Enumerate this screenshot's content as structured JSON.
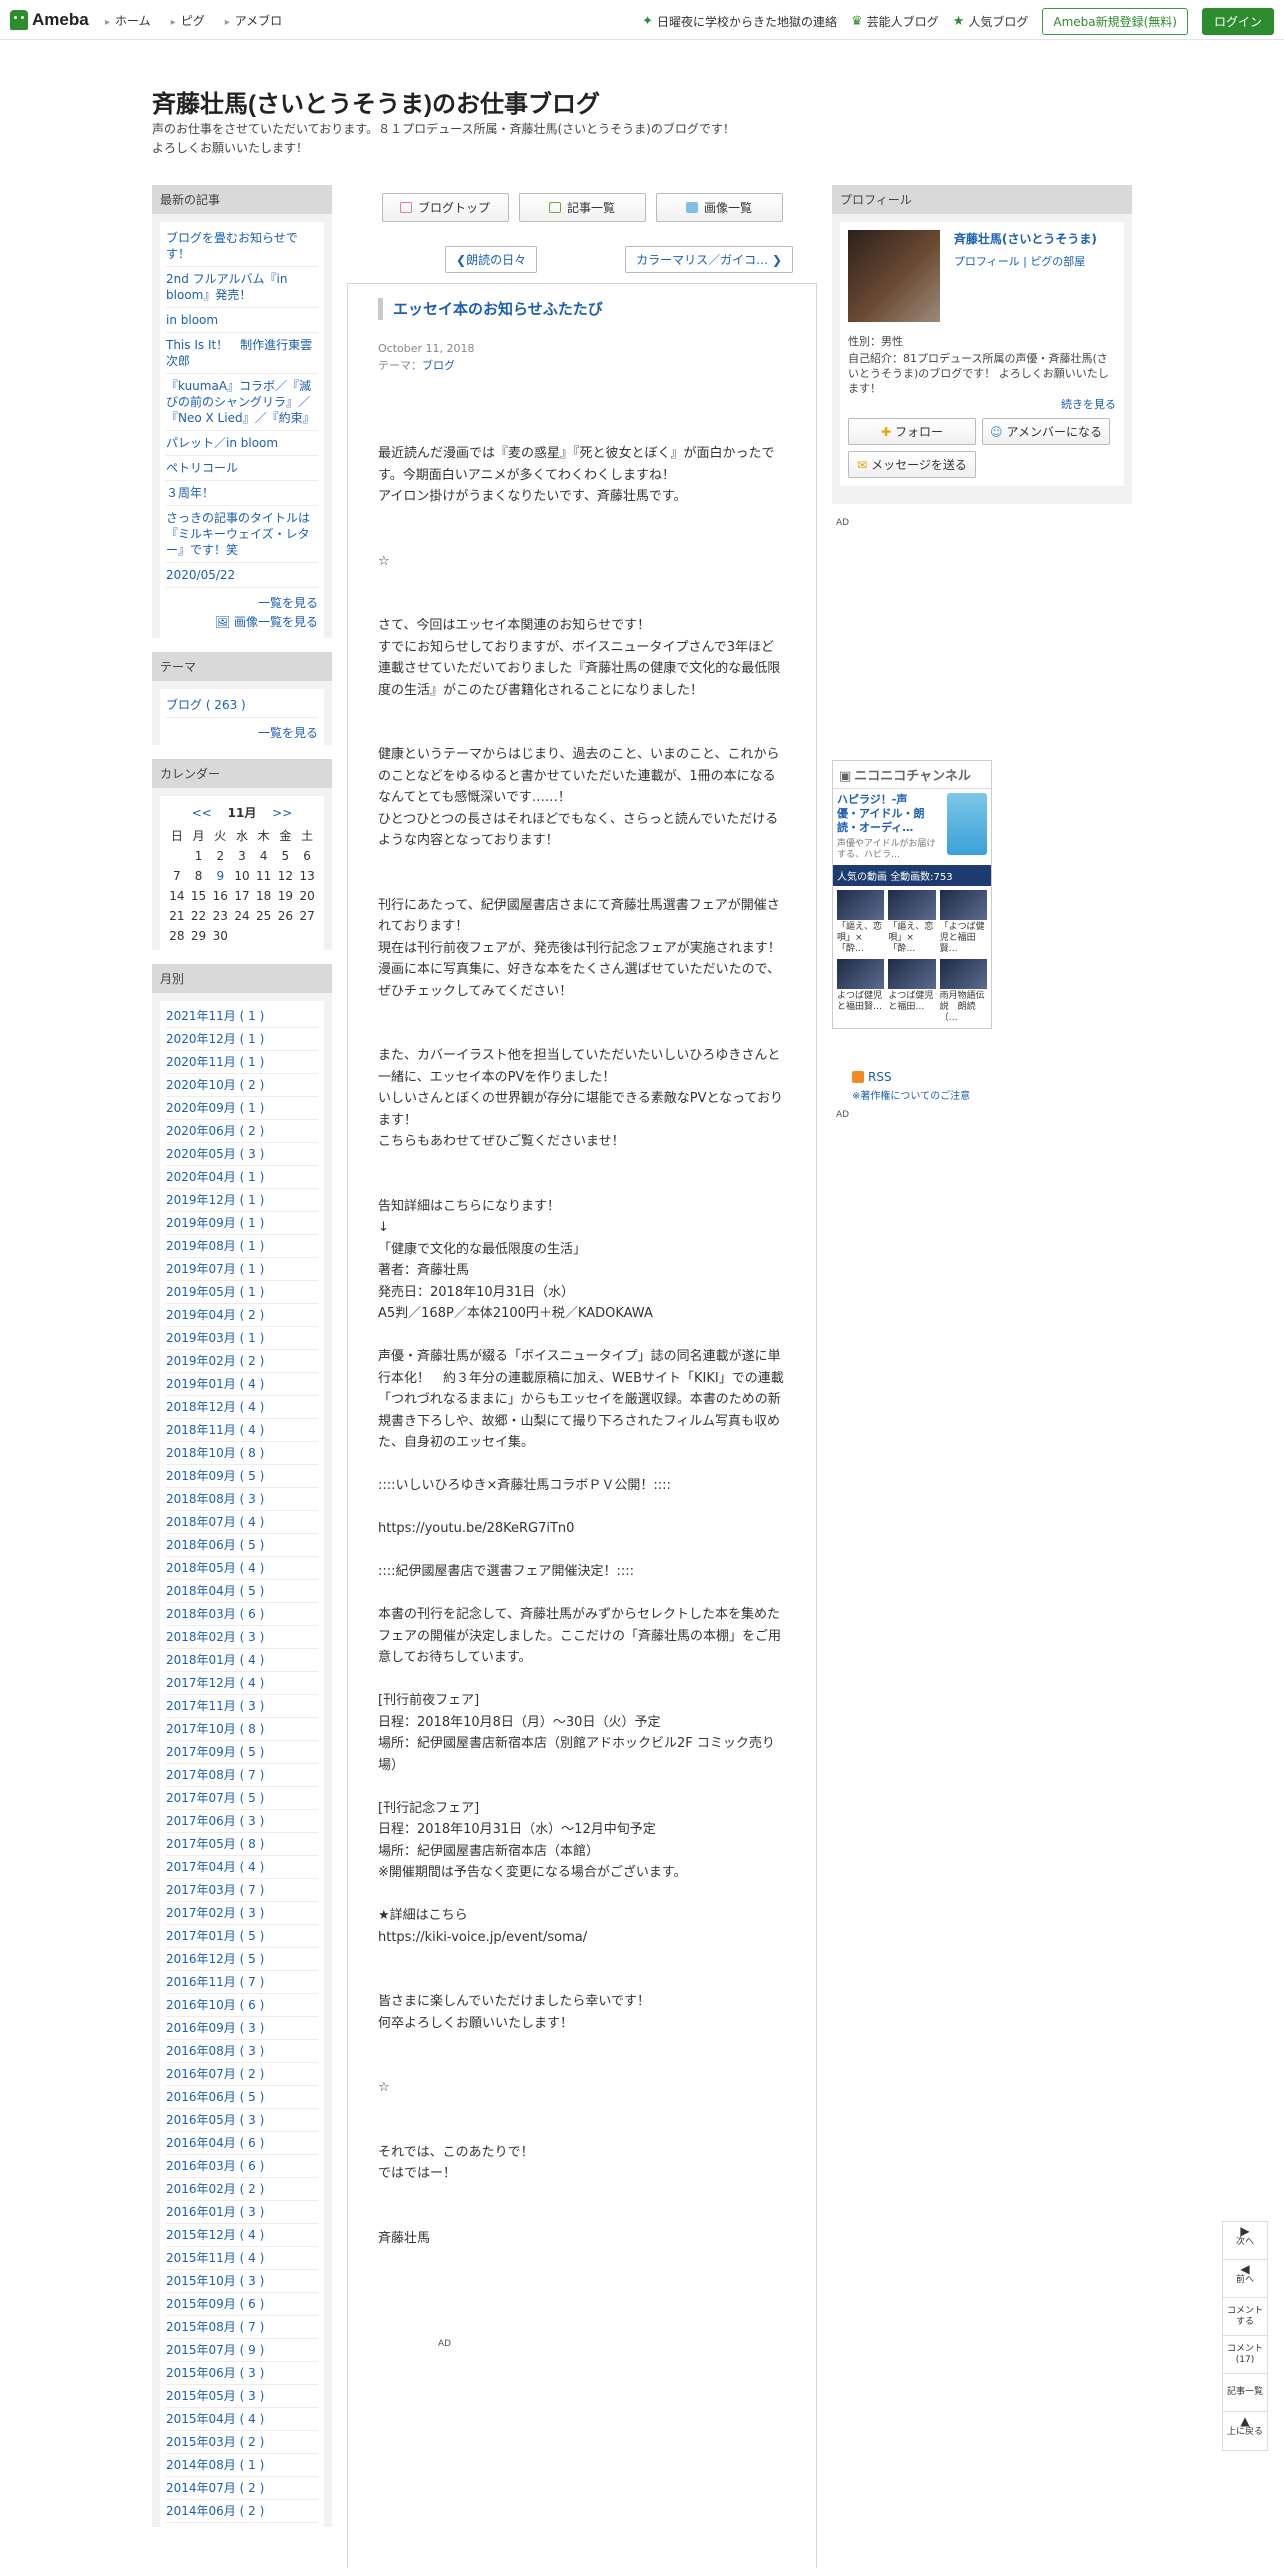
{
  "header": {
    "logo_text": "Ameba",
    "nav": [
      "ホーム",
      "ピグ",
      "アメブロ"
    ],
    "news_link": "日曜夜に学校からきた地獄の連絡",
    "celeb_link": "芸能人ブログ",
    "popular_link": "人気ブログ",
    "register_label": "Ameba新規登録(無料)",
    "login_label": "ログイン"
  },
  "blog": {
    "title": "斉藤壮馬(さいとうそうま)のお仕事ブログ",
    "desc_line1": "声のお仕事をさせていただいております。８１プロデュース所属・斉藤壮馬(さいとうそうま)のブログです！",
    "desc_line2": "よろしくお願いいたします！"
  },
  "left": {
    "recent_title": "最新の記事",
    "recent": [
      "ブログを畳むお知らせです！",
      "2nd フルアルバム『in bloom』発売！",
      "in bloom",
      "This Is It！　制作進行東雲次郎",
      "『kuumaA』コラボ／『滅びの前のシャングリラ』／『Neo X Lied』／『約束』",
      "パレット／in bloom",
      "ペトリコール",
      "３周年！",
      "さっきの記事のタイトルは『ミルキーウェイズ・レター』です！笑",
      "2020/05/22"
    ],
    "list_more": "一覧を見る",
    "image_more": "画像一覧を見る",
    "theme_title": "テーマ",
    "theme_item": "ブログ ( 263 )",
    "theme_more": "一覧を見る",
    "calendar_title": "カレンダー",
    "cal_prev": "<<",
    "cal_month": "11月",
    "cal_next": ">>",
    "weekdays": [
      "日",
      "月",
      "火",
      "水",
      "木",
      "金",
      "土"
    ],
    "weeks": [
      [
        "",
        "1",
        "2",
        "3",
        "4",
        "5",
        "6"
      ],
      [
        "7",
        "8",
        "9",
        "10",
        "11",
        "12",
        "13"
      ],
      [
        "14",
        "15",
        "16",
        "17",
        "18",
        "19",
        "20"
      ],
      [
        "21",
        "22",
        "23",
        "24",
        "25",
        "26",
        "27"
      ],
      [
        "28",
        "29",
        "30",
        "",
        "",
        "",
        ""
      ]
    ],
    "monthly_title": "月別",
    "months": [
      "2021年11月 ( 1 )",
      "2020年12月 ( 1 )",
      "2020年11月 ( 1 )",
      "2020年10月 ( 2 )",
      "2020年09月 ( 1 )",
      "2020年06月 ( 2 )",
      "2020年05月 ( 3 )",
      "2020年04月 ( 1 )",
      "2019年12月 ( 1 )",
      "2019年09月 ( 1 )",
      "2019年08月 ( 1 )",
      "2019年07月 ( 1 )",
      "2019年05月 ( 1 )",
      "2019年04月 ( 2 )",
      "2019年03月 ( 1 )",
      "2019年02月 ( 2 )",
      "2019年01月 ( 4 )",
      "2018年12月 ( 4 )",
      "2018年11月 ( 4 )",
      "2018年10月 ( 8 )",
      "2018年09月 ( 5 )",
      "2018年08月 ( 3 )",
      "2018年07月 ( 4 )",
      "2018年06月 ( 5 )",
      "2018年05月 ( 4 )",
      "2018年04月 ( 5 )",
      "2018年03月 ( 6 )",
      "2018年02月 ( 3 )",
      "2018年01月 ( 4 )",
      "2017年12月 ( 4 )",
      "2017年11月 ( 3 )",
      "2017年10月 ( 8 )",
      "2017年09月 ( 5 )",
      "2017年08月 ( 7 )",
      "2017年07月 ( 5 )",
      "2017年06月 ( 3 )",
      "2017年05月 ( 8 )",
      "2017年04月 ( 4 )",
      "2017年03月 ( 7 )",
      "2017年02月 ( 3 )",
      "2017年01月 ( 5 )",
      "2016年12月 ( 5 )",
      "2016年11月 ( 7 )",
      "2016年10月 ( 6 )",
      "2016年09月 ( 3 )",
      "2016年08月 ( 3 )",
      "2016年07月 ( 2 )",
      "2016年06月 ( 5 )",
      "2016年05月 ( 3 )",
      "2016年04月 ( 6 )",
      "2016年03月 ( 6 )",
      "2016年02月 ( 2 )",
      "2016年01月 ( 3 )",
      "2015年12月 ( 4 )",
      "2015年11月 ( 4 )",
      "2015年10月 ( 3 )",
      "2015年09月 ( 6 )",
      "2015年08月 ( 7 )",
      "2015年07月 ( 9 )",
      "2015年06月 ( 3 )",
      "2015年05月 ( 3 )",
      "2015年04月 ( 4 )",
      "2015年03月 ( 2 )",
      "2014年08月 ( 1 )",
      "2014年07月 ( 2 )",
      "2014年06月 ( 2 )"
    ]
  },
  "center": {
    "tab_top": "ブログトップ",
    "tab_list": "記事一覧",
    "tab_images": "画像一覧",
    "prev_label": "朗読の日々",
    "next_label": "カラーマリス／ガイコ…",
    "article_title": "エッセイ本のお知らせふたたび",
    "date": "October 11, 2018",
    "theme_prefix": "テーマ：",
    "theme_link": "ブログ",
    "body": "最近読んだ漫画では『麦の惑星』『死と彼女とぼく』が面白かったです。今期面白いアニメが多くてわくわくしますね！\nアイロン掛けがうまくなりたいです、斉藤壮馬です。\n\n\n☆\n\n\nさて、今回はエッセイ本関連のお知らせです！\nすでにお知らせしておりますが、ボイスニュータイプさんで3年ほど連載させていただいておりました『斉藤壮馬の健康で文化的な最低限度の生活』がこのたび書籍化されることになりました！\n\n\n健康というテーマからはじまり、過去のこと、いまのこと、これからのことなどをゆるゆると書かせていただいた連載が、1冊の本になるなんてとても感慨深いです……！\nひとつひとつの長さはそれほどでもなく、さらっと読んでいただけるような内容となっております！\n\n\n刊行にあたって、紀伊國屋書店さまにて斉藤壮馬選書フェアが開催されております！\n現在は刊行前夜フェアが、発売後は刊行記念フェアが実施されます！\n漫画に本に写真集に、好きな本をたくさん選ばせていただいたので、ぜひチェックしてみてください！\n\n\nまた、カバーイラスト他を担当していただいたいしいひろゆきさんと一緒に、エッセイ本のPVを作りました！\nいしいさんとぼくの世界観が存分に堪能できる素敵なPVとなっております！\nこちらもあわせてぜひご覧くださいませ！\n\n\n告知詳細はこちらになります！\n↓\n「健康で文化的な最低限度の生活」\n著者：斉藤壮馬\n発売日：2018年10月31日（水）\nA5判／168P／本体2100円＋税／KADOKAWA\n\n声優・斉藤壮馬が綴る「ボイスニュータイプ」誌の同名連載が遂に単行本化！　約３年分の連載原稿に加え、WEBサイト「KIKI」での連載「つれづれなるままに」からもエッセイを厳選収録。本書のための新規書き下ろしや、故郷・山梨にて撮り下ろされたフィルム写真も収めた、自身初のエッセイ集。\n\n::::いしいひろゆき×斉藤壮馬コラボＰＶ公開！::::\n\nhttps://youtu.be/28KeRG7iTn0\n\n::::紀伊國屋書店で選書フェア開催決定！::::\n\n本書の刊行を記念して、斉藤壮馬がみずからセレクトした本を集めたフェアの開催が決定しました。ここだけの「斉藤壮馬の本棚」をご用意してお待ちしています。\n\n[刊行前夜フェア]\n日程：2018年10月8日（月）～30日（火）予定\n場所：紀伊國屋書店新宿本店（別館アドホックビル2F コミック売り場）\n\n[刊行記念フェア]\n日程：2018年10月31日（水）～12月中旬予定\n場所：紀伊國屋書店新宿本店（本館）\n※開催期間は予告なく変更になる場合がございます。\n\n★詳細はこちら\nhttps://kiki-voice.jp/event/soma/\n\n\n皆さまに楽しんでいただけましたら幸いです！\n何卒よろしくお願いいたします！\n\n\n☆\n\n\nそれでは、このあたりで！\nではではー！\n\n\n斉藤壮馬",
    "ad_label": "AD"
  },
  "right": {
    "profile_title": "プロフィール",
    "name": "斉藤壮馬(さいとうそうま)",
    "profile_link": "プロフィール",
    "pig_link": "ピグの部屋",
    "gender": "性別：男性",
    "intro": "自己紹介：81プロデュース所属の声優・斉藤壮馬(さいとうそうま)のブログです！ よろしくお願いいたします！",
    "read_more": "続きを見る",
    "follow_label": "フォロー",
    "member_label": "アメンバーになる",
    "message_label": "メッセージを送る",
    "ad1": "AD",
    "nico_brand": "ニコニコチャンネル",
    "nico_title": "ハピラジ！-声優・アイドル・朗読・オーディ…",
    "nico_desc": "声優やアイドルがお届けする、ハピラ…",
    "nico_bar": "人気の動画",
    "nico_count": "全動画数:753",
    "nico_videos": [
      "「謳え、恋唄」×「酔…",
      "「謳え、恋唄」×「酔…",
      "「よつば健児と福田賢…",
      "よつば健児と福田賢…",
      "よつば健児と福田…",
      "雨月物語伝説　朗読（…"
    ],
    "rss_label": "RSS",
    "copyright_note": "※著作権についてのご注意",
    "ad2": "AD"
  },
  "sidenav": {
    "next": "次へ",
    "prev": "前へ",
    "comment": "コメントする",
    "comments": "コメント(17)",
    "list": "記事一覧",
    "top": "上に戻る"
  }
}
